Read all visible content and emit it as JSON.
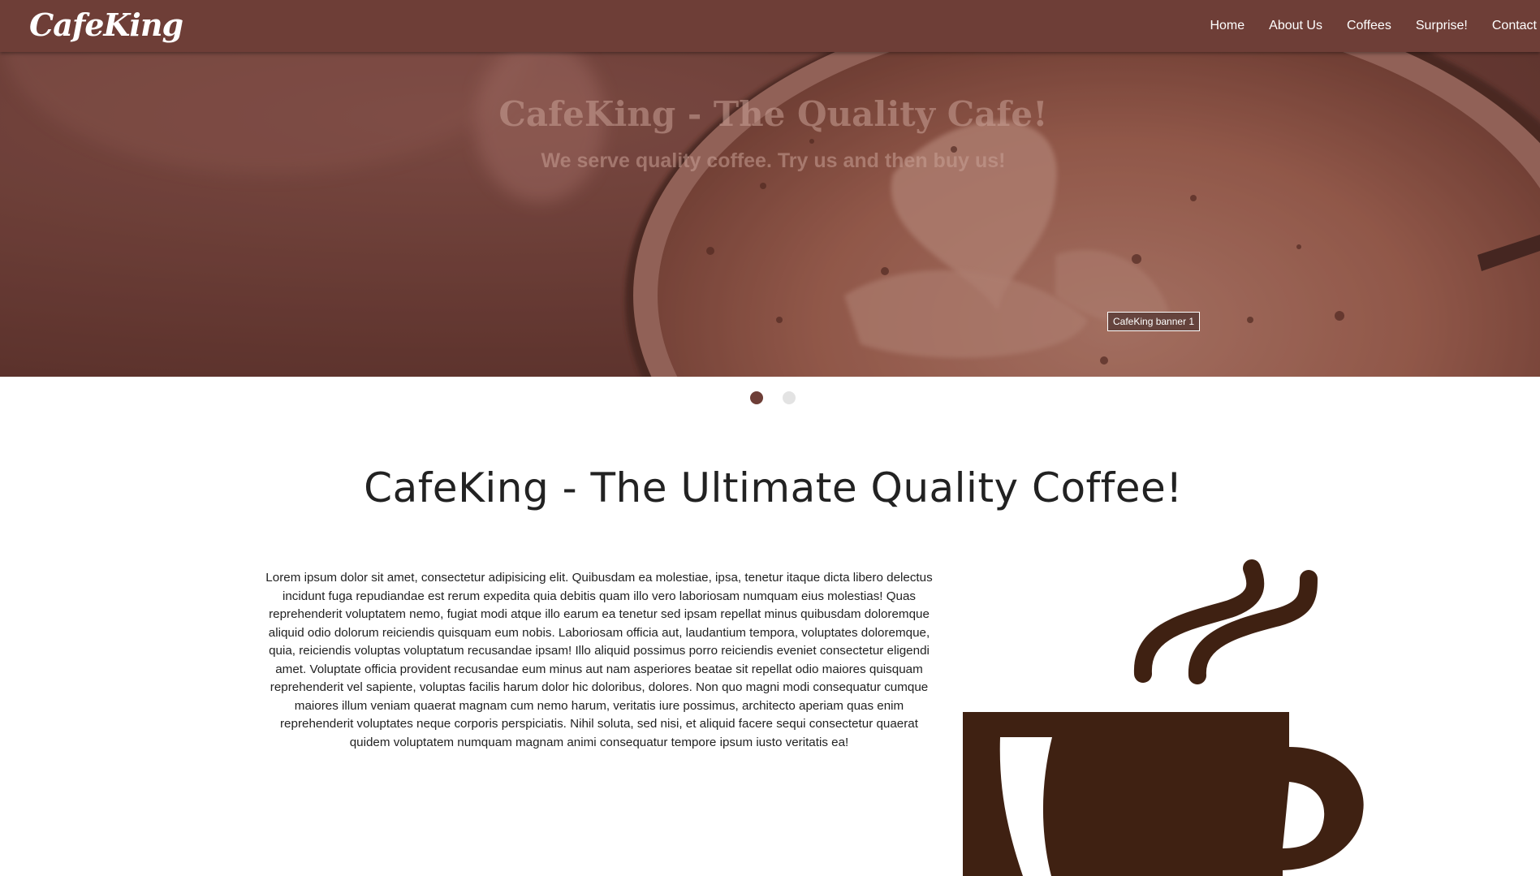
{
  "navbar": {
    "brand": "CafeKing",
    "links": [
      "Home",
      "About Us",
      "Coffees",
      "Surprise!",
      "Contact"
    ]
  },
  "hero": {
    "title": "CafeKing - The Quality Cafe!",
    "subtitle": "We serve quality coffee. Try us and then buy us!",
    "caption": "CafeKing banner 1",
    "slide_count": 2,
    "active_slide": 0
  },
  "main": {
    "title": "CafeKing - The Ultimate Quality Coffee!",
    "body": "Lorem ipsum dolor sit amet, consectetur adipisicing elit. Quibusdam ea molestiae, ipsa, tenetur itaque dicta libero delectus incidunt fuga repudiandae est rerum expedita quia debitis quam illo vero laboriosam numquam eius molestias! Quas reprehenderit voluptatem nemo, fugiat modi atque illo earum ea tenetur sed ipsam repellat minus quibusdam doloremque aliquid odio dolorum reiciendis quisquam eum nobis. Laboriosam officia aut, laudantium tempora, voluptates doloremque, quia, reiciendis voluptas voluptatum recusandae ipsam! Illo aliquid possimus porro reiciendis eveniet consectetur eligendi amet. Voluptate officia provident recusandae eum minus aut nam asperiores beatae sit repellat odio maiores quisquam reprehenderit vel sapiente, voluptas facilis harum dolor hic doloribus, dolores. Non quo magni modi consequatur cumque maiores illum veniam quaerat magnam cum nemo harum, veritatis iure possimus, architecto aperiam quas enim reprehenderit voluptates neque corporis perspiciatis. Nihil soluta, sed nisi, et aliquid facere sequi consectetur quaerat quidem voluptatem numquam magnam animi consequatur tempore ipsum iusto veritatis ea!"
  },
  "icons": {
    "coffee_cup": "coffee-cup-icon"
  },
  "colors": {
    "navbar": "#6e3e37",
    "accent": "#6e3e37",
    "cup": "#3f2112",
    "dot_inactive": "#e3e3e3"
  }
}
